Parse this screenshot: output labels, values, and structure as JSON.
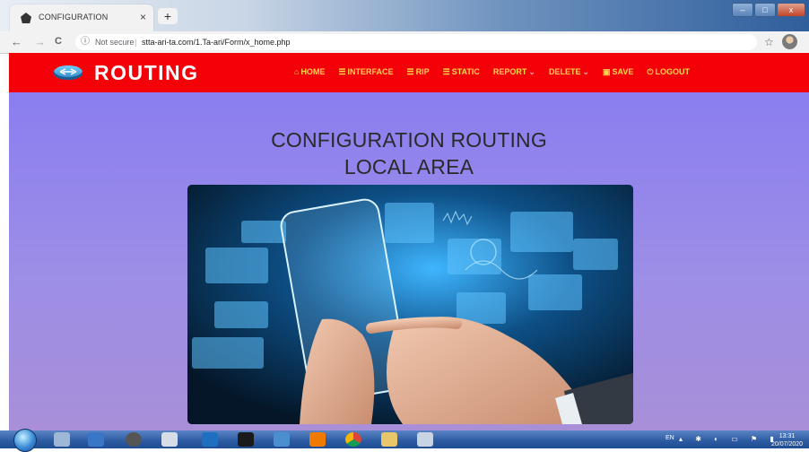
{
  "browser": {
    "tab_title": "CONFIGURATION",
    "tab_close": "×",
    "new_tab": "+",
    "window_buttons": [
      "–",
      "□",
      "x"
    ],
    "nav": {
      "back": "←",
      "forward": "→",
      "reload": "C"
    },
    "address": {
      "info_icon": "ⓘ",
      "security": "Not secure",
      "separator": "|",
      "url": "stta-ari-ta.com/1.Ta-ari/Form/x_home.php"
    },
    "bookmark_icon": "☆"
  },
  "site": {
    "brand": "ROUTING",
    "menu": [
      {
        "icon": "home-icon",
        "glyph": "⌂",
        "label": "HOME",
        "caret": ""
      },
      {
        "icon": "list-icon",
        "glyph": "☰",
        "label": "INTERFACE",
        "caret": ""
      },
      {
        "icon": "list-icon",
        "glyph": "☰",
        "label": "RIP",
        "caret": ""
      },
      {
        "icon": "list-icon",
        "glyph": "☰",
        "label": "STATIC",
        "caret": ""
      },
      {
        "icon": "",
        "glyph": "",
        "label": "REPORT",
        "caret": "⌄"
      },
      {
        "icon": "",
        "glyph": "",
        "label": "DELETE",
        "caret": "⌄"
      },
      {
        "icon": "save-icon",
        "glyph": "▣",
        "label": "SAVE",
        "caret": ""
      },
      {
        "icon": "logout-icon",
        "glyph": "⏻",
        "label": "LOGOUT",
        "caret": ""
      }
    ],
    "heading_line1": "CONFIGURATION ROUTING",
    "heading_line2": "LOCAL AREA",
    "colors": {
      "navbar": "#f40009",
      "menu_text": "#ffd84a",
      "content_bg": "#8a7ef0"
    }
  },
  "taskbar": {
    "language": "EN",
    "tray_glyphs": "▴ ✱ ◐ ▭ ⚑ ▮",
    "time": "13:31",
    "date": "20/07/2020"
  }
}
